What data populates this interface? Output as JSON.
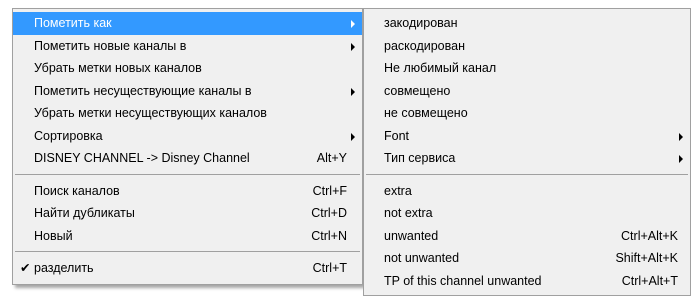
{
  "main_menu": {
    "groups": [
      [
        {
          "label": "Пометить как",
          "shortcut": "",
          "submenu": true,
          "highlighted": true
        },
        {
          "label": "Пометить новые каналы в",
          "shortcut": "",
          "submenu": true
        },
        {
          "label": "Убрать метки новых каналов",
          "shortcut": ""
        },
        {
          "label": "Пометить несуществующие каналы в",
          "shortcut": "",
          "submenu": true
        },
        {
          "label": "Убрать метки несуществующих каналов",
          "shortcut": ""
        },
        {
          "label": "Сортировка",
          "shortcut": "",
          "submenu": true
        },
        {
          "label": "DISNEY CHANNEL -> Disney Channel",
          "shortcut": "Alt+Y"
        }
      ],
      [
        {
          "label": "Поиск каналов",
          "shortcut": "Ctrl+F"
        },
        {
          "label": "Найти дубликаты",
          "shortcut": "Ctrl+D"
        },
        {
          "label": "Новый",
          "shortcut": "Ctrl+N"
        }
      ],
      [
        {
          "label": "разделить",
          "shortcut": "Ctrl+T",
          "checked": true
        }
      ]
    ]
  },
  "sub_menu": {
    "groups": [
      [
        {
          "label": "закодирован",
          "shortcut": ""
        },
        {
          "label": "раскодирован",
          "shortcut": ""
        },
        {
          "label": "Не любимый канал",
          "shortcut": ""
        },
        {
          "label": "совмещено",
          "shortcut": ""
        },
        {
          "label": "не совмещено",
          "shortcut": ""
        },
        {
          "label": "Font",
          "shortcut": "",
          "submenu": true
        },
        {
          "label": "Тип сервиса",
          "shortcut": "",
          "submenu": true
        }
      ],
      [
        {
          "label": "extra",
          "shortcut": ""
        },
        {
          "label": "not extra",
          "shortcut": ""
        },
        {
          "label": "unwanted",
          "shortcut": "Ctrl+Alt+K"
        },
        {
          "label": "not unwanted",
          "shortcut": "Shift+Alt+K"
        },
        {
          "label": "TP of this channel unwanted",
          "shortcut": "Ctrl+Alt+T"
        }
      ]
    ]
  },
  "check_glyph": "✔",
  "colors": {
    "highlight": "#3399ff",
    "menu_bg": "#f0f0f0",
    "separator": "#a0a0a0"
  }
}
